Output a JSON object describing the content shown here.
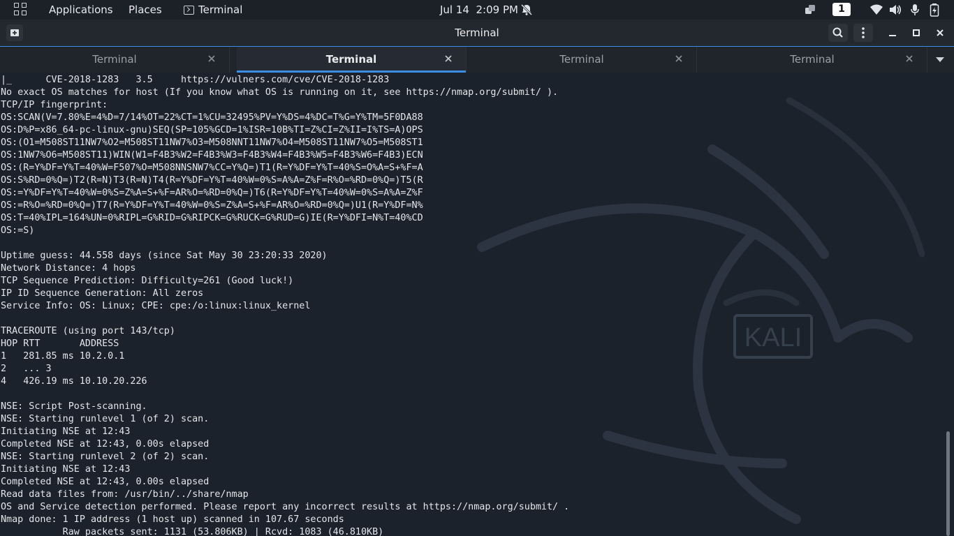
{
  "topbar": {
    "applications": "Applications",
    "places": "Places",
    "app_name": "Terminal",
    "date": "Jul 14",
    "time": "2:09 PM",
    "workspace": "1",
    "icons": [
      "apps-grid-icon",
      "terminal-icon",
      "notifications-off-icon",
      "multitask-icon",
      "wifi-icon",
      "volume-icon",
      "microphone-icon",
      "battery-icon"
    ]
  },
  "window": {
    "title": "Terminal",
    "icons": [
      "new-tab-icon",
      "search-icon",
      "menu-dots-icon",
      "minimize-icon",
      "maximize-icon",
      "close-icon"
    ]
  },
  "tabs": [
    {
      "label": "Terminal",
      "active": false
    },
    {
      "label": "Terminal",
      "active": true
    },
    {
      "label": "Terminal",
      "active": false
    },
    {
      "label": "Terminal",
      "active": false
    }
  ],
  "wallpaper": {
    "logo_text": "KALI"
  },
  "terminal": {
    "lines": [
      "|_      CVE-2018-1283   3.5     https://vulners.com/cve/CVE-2018-1283",
      "No exact OS matches for host (If you know what OS is running on it, see https://nmap.org/submit/ ).",
      "TCP/IP fingerprint:",
      "OS:SCAN(V=7.80%E=4%D=7/14%OT=22%CT=1%CU=32495%PV=Y%DS=4%DC=T%G=Y%TM=5F0DA88",
      "OS:D%P=x86_64-pc-linux-gnu)SEQ(SP=105%GCD=1%ISR=10B%TI=Z%CI=Z%II=I%TS=A)OPS",
      "OS:(O1=M508ST11NW7%O2=M508ST11NW7%O3=M508NNT11NW7%O4=M508ST11NW7%O5=M508ST1",
      "OS:1NW7%O6=M508ST11)WIN(W1=F4B3%W2=F4B3%W3=F4B3%W4=F4B3%W5=F4B3%W6=F4B3)ECN",
      "OS:(R=Y%DF=Y%T=40%W=F507%O=M508NNSNW7%CC=Y%Q=)T1(R=Y%DF=Y%T=40%S=O%A=S+%F=A",
      "OS:S%RD=0%Q=)T2(R=N)T3(R=N)T4(R=Y%DF=Y%T=40%W=0%S=A%A=Z%F=R%O=%RD=0%Q=)T5(R",
      "OS:=Y%DF=Y%T=40%W=0%S=Z%A=S+%F=AR%O=%RD=0%Q=)T6(R=Y%DF=Y%T=40%W=0%S=A%A=Z%F",
      "OS:=R%O=%RD=0%Q=)T7(R=Y%DF=Y%T=40%W=0%S=Z%A=S+%F=AR%O=%RD=0%Q=)U1(R=Y%DF=N%",
      "OS:T=40%IPL=164%UN=0%RIPL=G%RID=G%RIPCK=G%RUCK=G%RUD=G)IE(R=Y%DFI=N%T=40%CD",
      "OS:=S)",
      "",
      "Uptime guess: 44.558 days (since Sat May 30 23:20:33 2020)",
      "Network Distance: 4 hops",
      "TCP Sequence Prediction: Difficulty=261 (Good luck!)",
      "IP ID Sequence Generation: All zeros",
      "Service Info: OS: Linux; CPE: cpe:/o:linux:linux_kernel",
      "",
      "TRACEROUTE (using port 143/tcp)",
      "HOP RTT       ADDRESS",
      "1   281.85 ms 10.2.0.1",
      "2   ... 3",
      "4   426.19 ms 10.10.20.226",
      "",
      "NSE: Script Post-scanning.",
      "NSE: Starting runlevel 1 (of 2) scan.",
      "Initiating NSE at 12:43",
      "Completed NSE at 12:43, 0.00s elapsed",
      "NSE: Starting runlevel 2 (of 2) scan.",
      "Initiating NSE at 12:43",
      "Completed NSE at 12:43, 0.00s elapsed",
      "Read data files from: /usr/bin/../share/nmap",
      "OS and Service detection performed. Please report any incorrect results at https://nmap.org/submit/ .",
      "Nmap done: 1 IP address (1 host up) scanned in 107.67 seconds",
      "           Raw packets sent: 1131 (53.806KB) | Rcvd: 1083 (46.810KB)"
    ]
  }
}
